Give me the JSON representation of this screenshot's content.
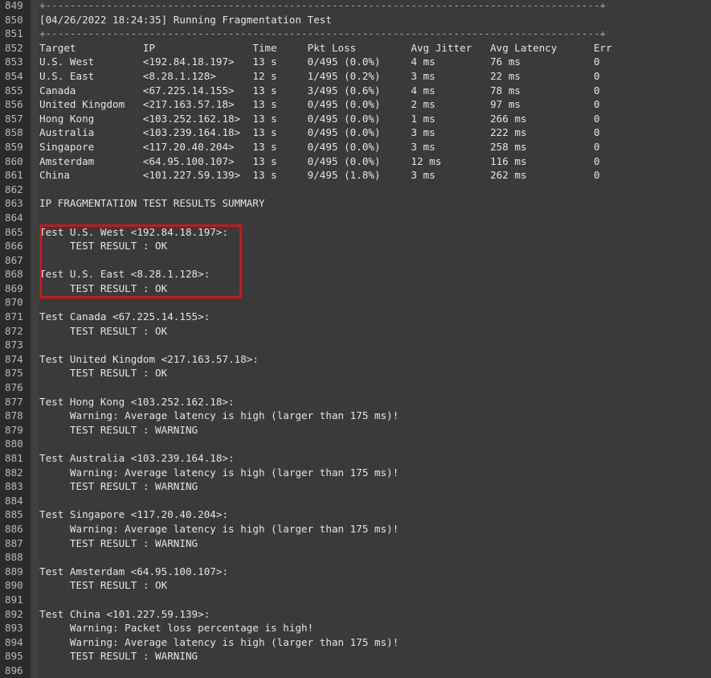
{
  "colors": {
    "background": "#3a3a3a",
    "gutter": "#2b2b2b",
    "text": "#e4e4e4",
    "line_number": "#b9b9b9",
    "highlight_border": "#d0141c"
  },
  "lines": [
    {
      "n": "849",
      "t": "+-------------------------------------------------------------------------------------------+"
    },
    {
      "n": "850",
      "t": "[04/26/2022 18:24:35] Running Fragmentation Test"
    },
    {
      "n": "851",
      "t": "+-------------------------------------------------------------------------------------------+"
    },
    {
      "n": "852",
      "t": "Target           IP                Time     Pkt Loss         Avg Jitter   Avg Latency      Err"
    },
    {
      "n": "853",
      "t": "U.S. West        <192.84.18.197>   13 s     0/495 (0.0%)     4 ms         76 ms            0"
    },
    {
      "n": "854",
      "t": "U.S. East        <8.28.1.128>      12 s     1/495 (0.2%)     3 ms         22 ms            0"
    },
    {
      "n": "855",
      "t": "Canada           <67.225.14.155>   13 s     3/495 (0.6%)     4 ms         78 ms            0"
    },
    {
      "n": "856",
      "t": "United Kingdom   <217.163.57.18>   13 s     0/495 (0.0%)     2 ms         97 ms            0"
    },
    {
      "n": "857",
      "t": "Hong Kong        <103.252.162.18>  13 s     0/495 (0.0%)     1 ms         266 ms           0"
    },
    {
      "n": "858",
      "t": "Australia        <103.239.164.18>  13 s     0/495 (0.0%)     3 ms         222 ms           0"
    },
    {
      "n": "859",
      "t": "Singapore        <117.20.40.204>   13 s     0/495 (0.0%)     3 ms         258 ms           0"
    },
    {
      "n": "860",
      "t": "Amsterdam        <64.95.100.107>   13 s     0/495 (0.0%)     12 ms        116 ms           0"
    },
    {
      "n": "861",
      "t": "China            <101.227.59.139>  13 s     9/495 (1.8%)     3 ms         262 ms           0"
    },
    {
      "n": "862",
      "t": ""
    },
    {
      "n": "863",
      "t": "IP FRAGMENTATION TEST RESULTS SUMMARY"
    },
    {
      "n": "864",
      "t": ""
    },
    {
      "n": "865",
      "t": "Test U.S. West <192.84.18.197>:"
    },
    {
      "n": "866",
      "t": "     TEST RESULT : OK"
    },
    {
      "n": "867",
      "t": ""
    },
    {
      "n": "868",
      "t": "Test U.S. East <8.28.1.128>:"
    },
    {
      "n": "869",
      "t": "     TEST RESULT : OK"
    },
    {
      "n": "870",
      "t": ""
    },
    {
      "n": "871",
      "t": "Test Canada <67.225.14.155>:"
    },
    {
      "n": "872",
      "t": "     TEST RESULT : OK"
    },
    {
      "n": "873",
      "t": ""
    },
    {
      "n": "874",
      "t": "Test United Kingdom <217.163.57.18>:"
    },
    {
      "n": "875",
      "t": "     TEST RESULT : OK"
    },
    {
      "n": "876",
      "t": ""
    },
    {
      "n": "877",
      "t": "Test Hong Kong <103.252.162.18>:"
    },
    {
      "n": "878",
      "t": "     Warning: Average latency is high (larger than 175 ms)!"
    },
    {
      "n": "879",
      "t": "     TEST RESULT : WARNING"
    },
    {
      "n": "880",
      "t": ""
    },
    {
      "n": "881",
      "t": "Test Australia <103.239.164.18>:"
    },
    {
      "n": "882",
      "t": "     Warning: Average latency is high (larger than 175 ms)!"
    },
    {
      "n": "883",
      "t": "     TEST RESULT : WARNING"
    },
    {
      "n": "884",
      "t": ""
    },
    {
      "n": "885",
      "t": "Test Singapore <117.20.40.204>:"
    },
    {
      "n": "886",
      "t": "     Warning: Average latency is high (larger than 175 ms)!"
    },
    {
      "n": "887",
      "t": "     TEST RESULT : WARNING"
    },
    {
      "n": "888",
      "t": ""
    },
    {
      "n": "889",
      "t": "Test Amsterdam <64.95.100.107>:"
    },
    {
      "n": "890",
      "t": "     TEST RESULT : OK"
    },
    {
      "n": "891",
      "t": ""
    },
    {
      "n": "892",
      "t": "Test China <101.227.59.139>:"
    },
    {
      "n": "893",
      "t": "     Warning: Packet loss percentage is high!"
    },
    {
      "n": "894",
      "t": "     Warning: Average latency is high (larger than 175 ms)!"
    },
    {
      "n": "895",
      "t": "     TEST RESULT : WARNING"
    },
    {
      "n": "896",
      "t": ""
    }
  ]
}
